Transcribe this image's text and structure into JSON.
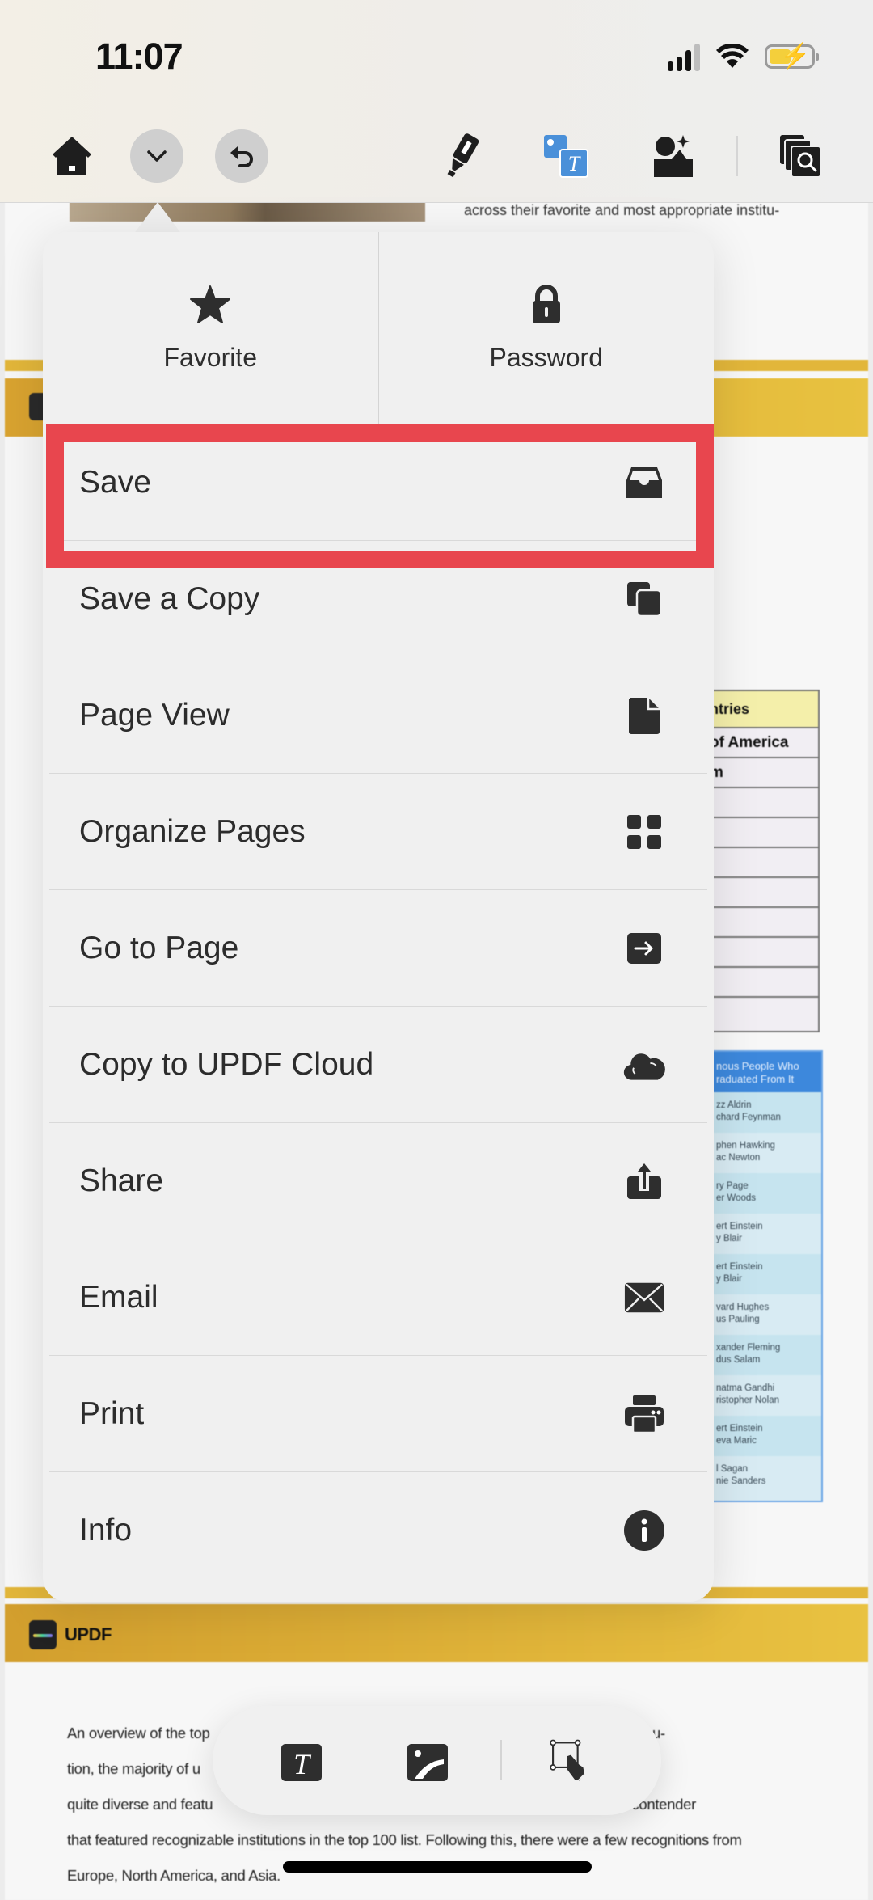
{
  "status_bar": {
    "time": "11:07",
    "icons": [
      "signal-icon",
      "wifi-icon",
      "battery-charging-icon"
    ],
    "battery_color": "#f4cf3b"
  },
  "toolbar": {
    "left": [
      {
        "name": "home",
        "icon": "home-icon"
      },
      {
        "name": "more",
        "icon": "chevron-down-icon",
        "active": true
      },
      {
        "name": "undo",
        "icon": "undo-icon"
      }
    ],
    "right": [
      {
        "name": "highlighter",
        "icon": "highlighter-icon"
      },
      {
        "name": "edit-text-image",
        "icon": "edit-text-image-icon",
        "accent": "#4a90d9"
      },
      {
        "name": "ai-assistant",
        "icon": "ai-image-icon"
      },
      {
        "name": "search-pages",
        "icon": "search-pages-icon"
      }
    ]
  },
  "popover": {
    "top_actions": [
      {
        "label": "Favorite",
        "icon": "star-icon"
      },
      {
        "label": "Password",
        "icon": "lock-icon"
      }
    ],
    "items": [
      {
        "label": "Save",
        "icon": "inbox-tray-icon",
        "highlighted": true
      },
      {
        "label": "Save a Copy",
        "icon": "copy-icon"
      },
      {
        "label": "Page View",
        "icon": "document-icon"
      },
      {
        "label": "Organize Pages",
        "icon": "grid-icon"
      },
      {
        "label": "Go to Page",
        "icon": "arrow-right-box-icon"
      },
      {
        "label": "Copy to UPDF Cloud",
        "icon": "cloud-icon"
      },
      {
        "label": "Share",
        "icon": "share-icon"
      },
      {
        "label": "Email",
        "icon": "envelope-icon"
      },
      {
        "label": "Print",
        "icon": "printer-icon"
      },
      {
        "label": "Info",
        "icon": "info-icon"
      }
    ],
    "highlight_color": "#e8464e"
  },
  "document": {
    "top_line": "across their favorite and most appropriate institu-",
    "yellow_table": {
      "header": "ntries",
      "rows": [
        "of America",
        "m",
        "",
        "",
        "",
        "",
        "",
        "",
        ""
      ]
    },
    "blue_table": {
      "header": [
        "nous People Who",
        "raduated From It"
      ],
      "rows": [
        [
          "zz Aldrin",
          "chard Feynman"
        ],
        [
          "phen Hawking",
          "ac Newton"
        ],
        [
          "ry Page",
          "er Woods"
        ],
        [
          "ert Einstein",
          "y Blair"
        ],
        [
          "ert Einstein",
          "y Blair"
        ],
        [
          "vard Hughes",
          "us Pauling"
        ],
        [
          "xander Fleming",
          "dus Salam"
        ],
        [
          "natma Gandhi",
          "ristopher Nolan"
        ],
        [
          "ert Einstein",
          "eva Maric"
        ],
        [
          "l Sagan",
          "nie Sanders"
        ]
      ]
    },
    "brand": "UPDF",
    "paragraph_lines": [
      "An overview of the top                                                                                   . In terms of distribu-",
      "tion, the majority of u                                                                                   , the division was still",
      "quite diverse and featu                                                                                   gdom was the contender",
      "that featured recognizable institutions in the top 100 list. Following this, there were a few recognitions from",
      "Europe, North America, and Asia."
    ]
  },
  "bottom_toolbar": {
    "tools": [
      {
        "name": "add-text",
        "icon": "text-tool-icon"
      },
      {
        "name": "add-image",
        "icon": "image-tool-icon"
      },
      {
        "name": "select",
        "icon": "select-hand-icon"
      }
    ]
  }
}
